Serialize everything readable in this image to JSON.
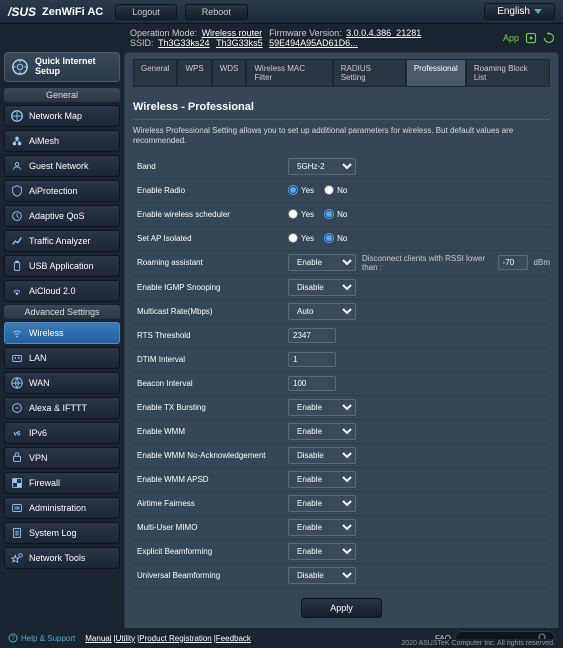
{
  "header": {
    "brand": "/SUS",
    "product": "ZenWiFi AC",
    "logout": "Logout",
    "reboot": "Reboot",
    "language": "English"
  },
  "info": {
    "mode_label": "Operation Mode:",
    "mode_value": "Wireless router",
    "fw_label": "Firmware Version:",
    "fw_value": "3.0.0.4.386_21281",
    "ssid_label": "SSID:",
    "ssid1": "Th3G33ks24",
    "ssid2": "Th3G33ks5",
    "ssid3": "59E494A95AD61D6...",
    "app": "App"
  },
  "sidebar": {
    "quick1": "Quick Internet",
    "quick2": "Setup",
    "general_header": "General",
    "advanced_header": "Advanced Settings",
    "general": [
      {
        "label": "Network Map"
      },
      {
        "label": "AiMesh"
      },
      {
        "label": "Guest Network"
      },
      {
        "label": "AiProtection"
      },
      {
        "label": "Adaptive QoS"
      },
      {
        "label": "Traffic Analyzer"
      },
      {
        "label": "USB Application"
      },
      {
        "label": "AiCloud 2.0"
      }
    ],
    "advanced": [
      {
        "label": "Wireless"
      },
      {
        "label": "LAN"
      },
      {
        "label": "WAN"
      },
      {
        "label": "Alexa & IFTTT"
      },
      {
        "label": "IPv6"
      },
      {
        "label": "VPN"
      },
      {
        "label": "Firewall"
      },
      {
        "label": "Administration"
      },
      {
        "label": "System Log"
      },
      {
        "label": "Network Tools"
      }
    ]
  },
  "tabs": [
    "General",
    "WPS",
    "WDS",
    "Wireless MAC Filter",
    "RADIUS Setting",
    "Professional",
    "Roaming Block List"
  ],
  "panel": {
    "title": "Wireless - Professional",
    "desc": "Wireless Professional Setting allows you to set up additional parameters for wireless. But default values are recommended."
  },
  "labels": {
    "yes": "Yes",
    "no": "No",
    "band": "Band",
    "enable_radio": "Enable Radio",
    "enable_scheduler": "Enable wireless scheduler",
    "set_ap_isolated": "Set AP Isolated",
    "roaming_assistant": "Roaming assistant",
    "roaming_extra": "Disconnect clients with RSSI lower than :",
    "roaming_unit": "dBm",
    "igmp": "Enable IGMP Snooping",
    "multicast": "Multicast Rate(Mbps)",
    "rts": "RTS Threshold",
    "dtim": "DTIM Interval",
    "beacon": "Beacon Interval",
    "tx_burst": "Enable TX Bursting",
    "wmm": "Enable WMM",
    "wmm_noack": "Enable WMM No-Acknowledgement",
    "wmm_apsd": "Enable WMM APSD",
    "airtime": "Airtime Fairness",
    "mu_mimo": "Multi-User MIMO",
    "explicit_bf": "Explicit Beamforming",
    "universal_bf": "Universal Beamforming",
    "apply": "Apply"
  },
  "values": {
    "band": "5GHz-2",
    "enable_radio": "yes",
    "enable_scheduler": "no",
    "set_ap_isolated": "no",
    "roaming_assistant": "Enable",
    "roaming_rssi": "-70",
    "igmp": "Disable",
    "multicast": "Auto",
    "rts": "2347",
    "dtim": "1",
    "beacon": "100",
    "tx_burst": "Enable",
    "wmm": "Enable",
    "wmm_noack": "Disable",
    "wmm_apsd": "Enable",
    "airtime": "Enable",
    "mu_mimo": "Enable",
    "explicit_bf": "Enable",
    "universal_bf": "Disable"
  },
  "footer": {
    "help": "Help & Support",
    "manual": "Manual",
    "utility": "Utility",
    "prodreg": "Product Registration",
    "feedback": "Feedback",
    "faq": "FAQ",
    "copyright": "2020 ASUSTeK Computer Inc. All rights reserved."
  }
}
